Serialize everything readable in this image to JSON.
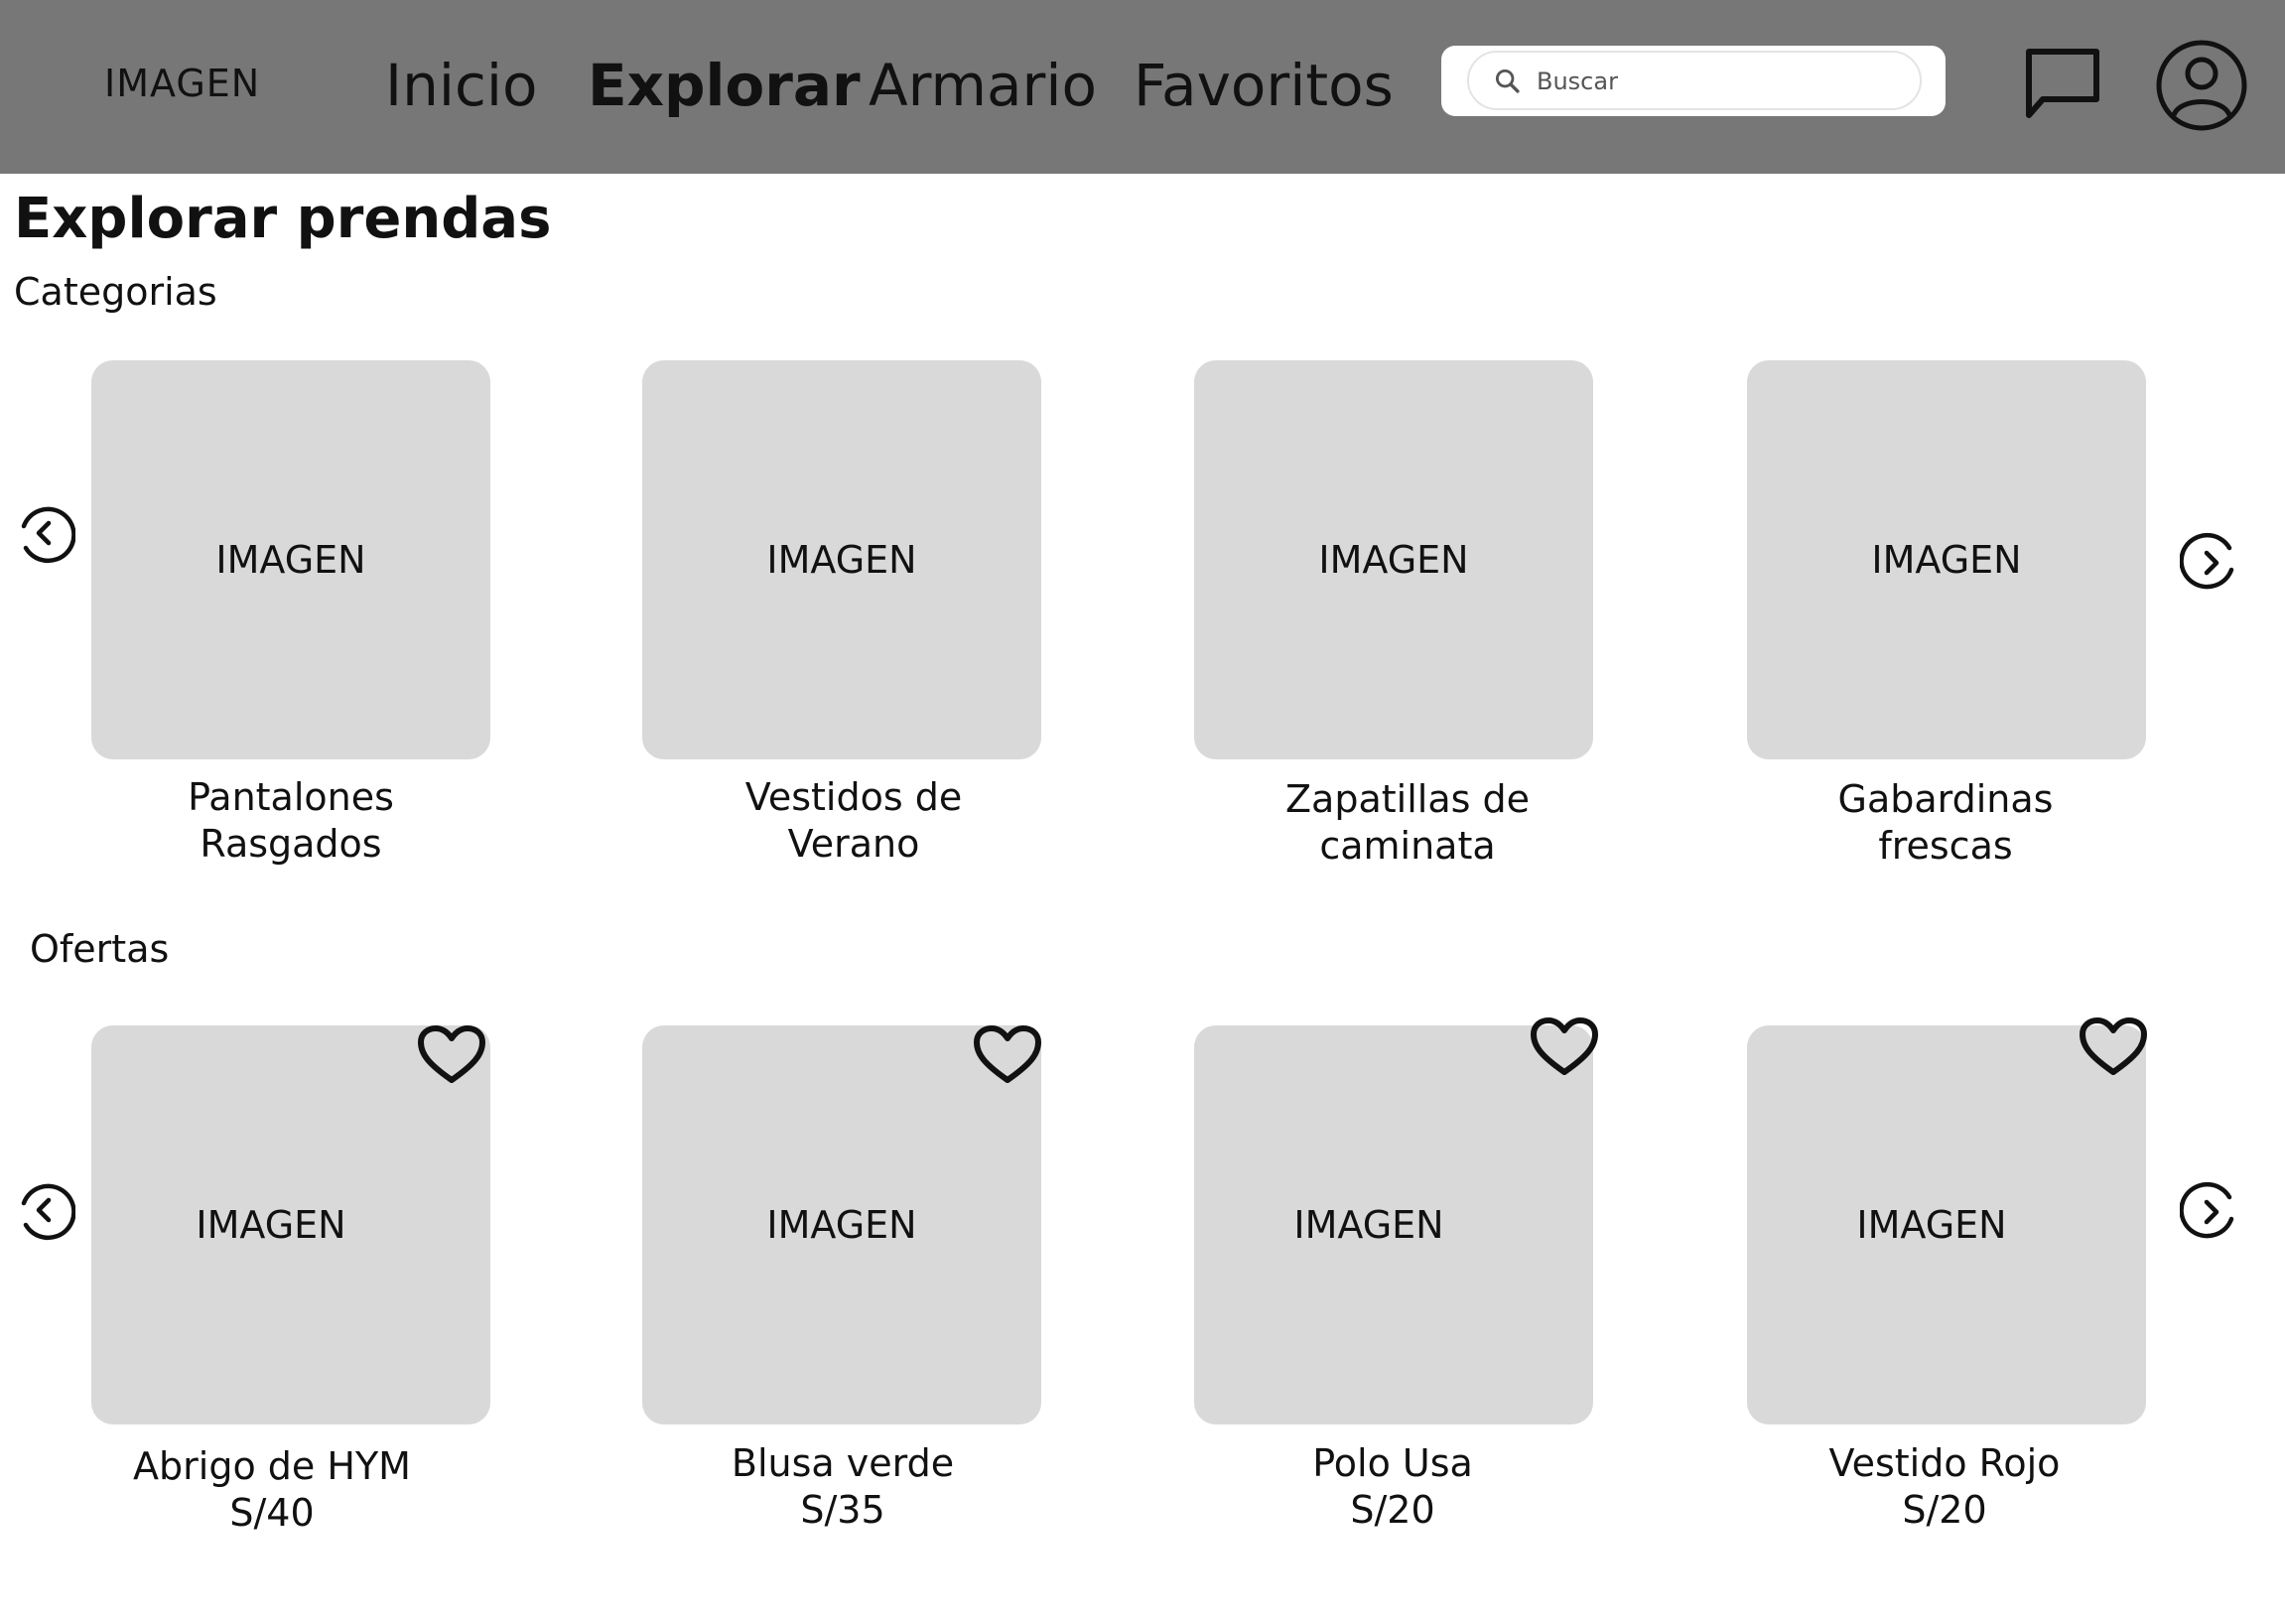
{
  "header": {
    "logo": "IMAGEN",
    "nav": [
      {
        "label": "Inicio",
        "active": false
      },
      {
        "label": "Explorar",
        "active": true
      },
      {
        "label": "Armario",
        "active": false
      },
      {
        "label": "Favoritos",
        "active": false
      }
    ],
    "search": {
      "placeholder": "Buscar",
      "value": ""
    },
    "icons": [
      "search-icon",
      "chat-icon",
      "user-icon"
    ]
  },
  "page": {
    "title": "Explorar prendas"
  },
  "categories": {
    "title": "Categorias",
    "items": [
      {
        "image": "IMAGEN",
        "line1": "Pantalones",
        "line2": "Rasgados"
      },
      {
        "image": "IMAGEN",
        "line1": "Vestidos de",
        "line2": "Verano"
      },
      {
        "image": "IMAGEN",
        "line1": "Zapatillas de",
        "line2": "caminata"
      },
      {
        "image": "IMAGEN",
        "line1": "Gabardinas",
        "line2": "frescas"
      }
    ]
  },
  "offers": {
    "title": "Ofertas",
    "items": [
      {
        "image": "IMAGEN",
        "name": "Abrigo de HYM",
        "price": "S/40"
      },
      {
        "image": "IMAGEN",
        "name": "Blusa verde",
        "price": "S/35"
      },
      {
        "image": "IMAGEN",
        "name": "Polo Usa",
        "price": "S/20"
      },
      {
        "image": "IMAGEN",
        "name": "Vestido Rojo",
        "price": "S/20"
      }
    ]
  },
  "colors": {
    "header_bg": "#777777",
    "card_bg": "#d9d9d9",
    "text": "#111111"
  }
}
